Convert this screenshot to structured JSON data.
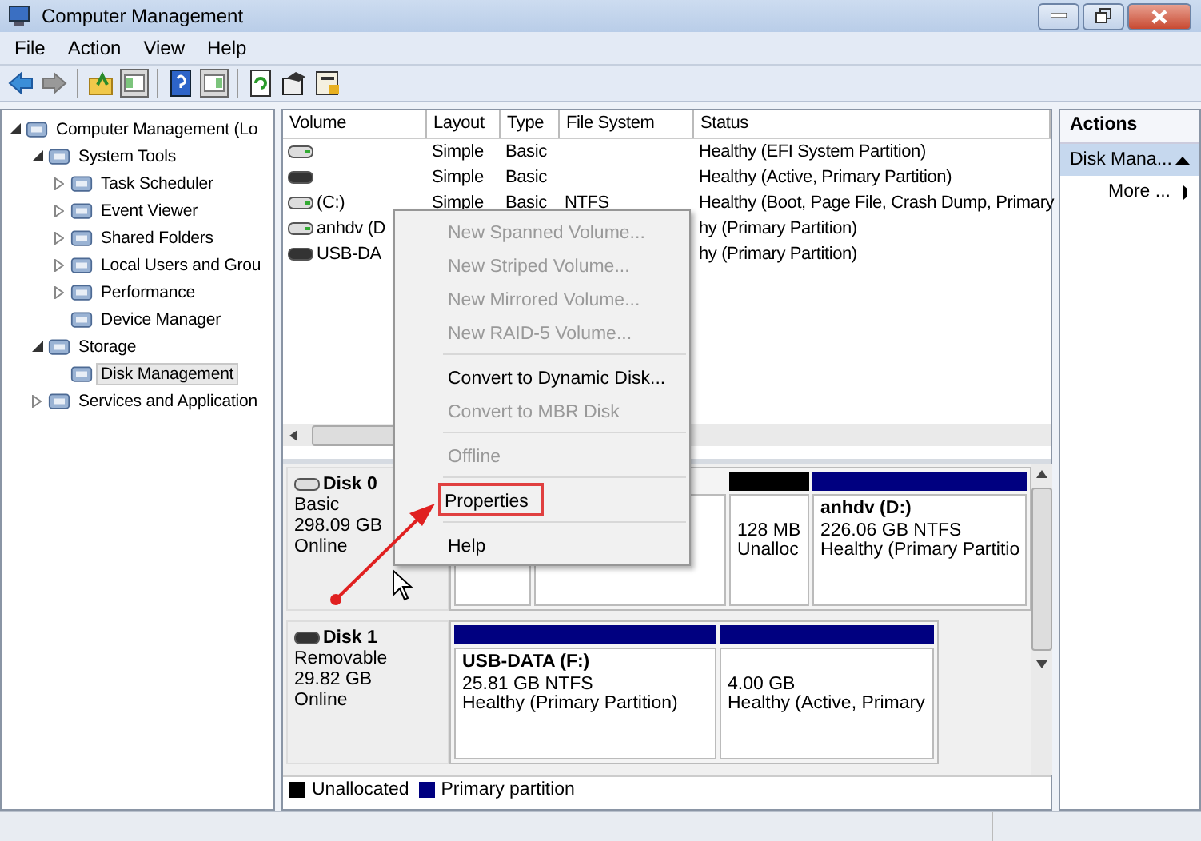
{
  "window": {
    "title": "Computer Management"
  },
  "menu_bar": [
    "File",
    "Action",
    "View",
    "Help"
  ],
  "tree": [
    {
      "label": "Computer Management (Lo",
      "expanded": true,
      "selected": false,
      "children": [
        {
          "label": "System Tools",
          "expanded": true,
          "selected": false,
          "children": [
            {
              "label": "Task Scheduler",
              "expanded": false,
              "selected": false
            },
            {
              "label": "Event Viewer",
              "expanded": false,
              "selected": false
            },
            {
              "label": "Shared Folders",
              "expanded": false,
              "selected": false
            },
            {
              "label": "Local Users and Grou",
              "expanded": false,
              "selected": false
            },
            {
              "label": "Performance",
              "expanded": false,
              "selected": false
            },
            {
              "label": "Device Manager",
              "selected": false
            }
          ]
        },
        {
          "label": "Storage",
          "expanded": true,
          "selected": false,
          "children": [
            {
              "label": "Disk Management",
              "selected": true
            }
          ]
        },
        {
          "label": "Services and Application",
          "expanded": false,
          "selected": false
        }
      ]
    }
  ],
  "table": {
    "columns": [
      "Volume",
      "Layout",
      "Type",
      "File System",
      "Status"
    ],
    "rows": [
      {
        "kind": "plain",
        "layout": "Simple",
        "type": "Basic",
        "status": "Healthy (EFI System Partition)"
      },
      {
        "kind": "dark",
        "layout": "Simple",
        "type": "Basic",
        "status": "Healthy (Active, Primary Partition)"
      },
      {
        "kind": "plain",
        "volume": "(C:)",
        "layout": "Simple",
        "type": "Basic",
        "file_system": "NTFS",
        "status": "Healthy (Boot, Page File, Crash Dump, Primary"
      },
      {
        "kind": "plain",
        "volume": "anhdv (D",
        "status": "hy (Primary Partition)"
      },
      {
        "kind": "dark",
        "volume": "USB-DA",
        "status": "hy (Primary Partition)"
      }
    ]
  },
  "disks": [
    {
      "kind": "plain",
      "name": "Disk 0",
      "type": "Basic",
      "size": "298.09 GB",
      "status": "Online",
      "partitions": [
        {
          "kind": "covered"
        },
        {
          "kind": "covered"
        },
        {
          "kind": "unallocated",
          "lines": [
            "128 MB",
            "Unalloc"
          ]
        },
        {
          "kind": "primary",
          "title": "anhdv  (D:)",
          "lines": [
            "226.06 GB NTFS",
            "Healthy (Primary Partitio"
          ]
        }
      ]
    },
    {
      "kind": "dark",
      "name": "Disk 1",
      "type": "Removable",
      "size": "29.82 GB",
      "status": "Online",
      "partitions": [
        {
          "kind": "primary",
          "title": "USB-DATA  (F:)",
          "lines": [
            "25.81 GB NTFS",
            "Healthy (Primary Partition)"
          ]
        },
        {
          "kind": "primary",
          "lines": [
            "4.00 GB",
            "Healthy (Active, Primary"
          ]
        }
      ]
    }
  ],
  "legend": [
    {
      "label": "Unallocated",
      "color": "#000000"
    },
    {
      "label": "Primary partition",
      "color": "#000080"
    }
  ],
  "actions": {
    "title": "Actions",
    "section": "Disk Mana...",
    "items": [
      "More ..."
    ]
  },
  "context_menu": [
    {
      "kind": "item",
      "label": "New Spanned Volume...",
      "disabled": true,
      "annotated": false
    },
    {
      "kind": "item",
      "label": "New Striped Volume...",
      "disabled": true,
      "annotated": false
    },
    {
      "kind": "item",
      "label": "New Mirrored Volume...",
      "disabled": true,
      "annotated": false
    },
    {
      "kind": "item",
      "label": "New RAID-5 Volume...",
      "disabled": true,
      "annotated": false
    },
    {
      "kind": "separator"
    },
    {
      "kind": "item",
      "label": "Convert to Dynamic Disk...",
      "disabled": false,
      "annotated": false
    },
    {
      "kind": "item",
      "label": "Convert to MBR Disk",
      "disabled": true,
      "annotated": false
    },
    {
      "kind": "separator"
    },
    {
      "kind": "item",
      "label": "Offline",
      "disabled": true,
      "annotated": false
    },
    {
      "kind": "separator"
    },
    {
      "kind": "item",
      "label": "Properties",
      "disabled": false,
      "annotated": true
    },
    {
      "kind": "separator"
    },
    {
      "kind": "item",
      "label": "Help",
      "disabled": false,
      "annotated": false
    }
  ]
}
